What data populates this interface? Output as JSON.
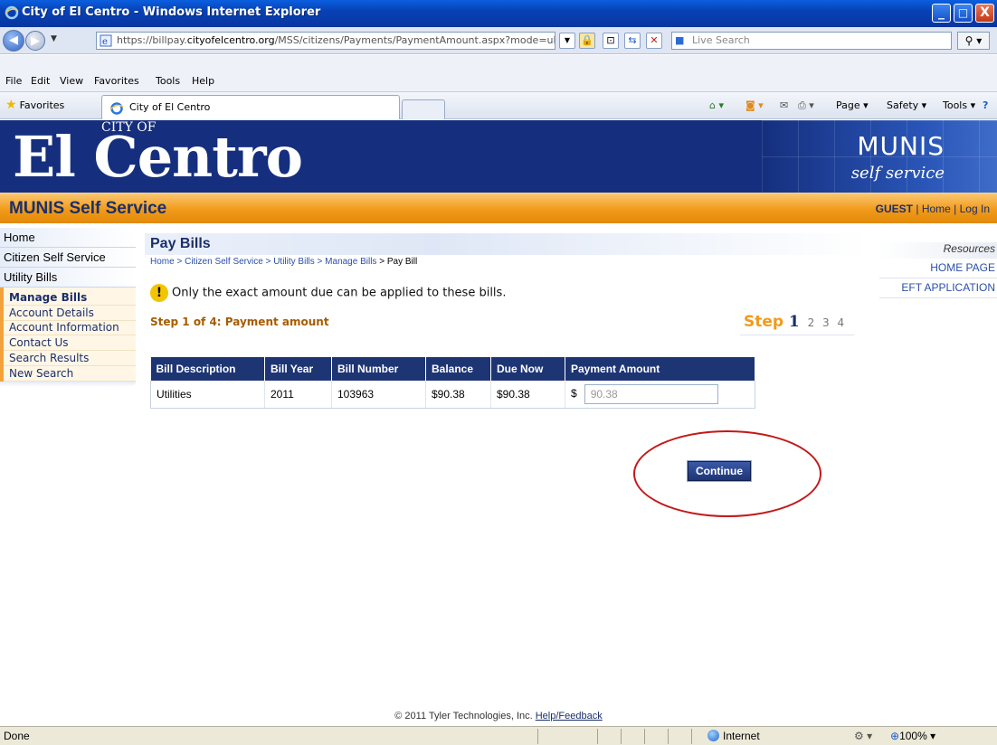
{
  "window": {
    "title": "City of El Centro - Windows Internet Explorer",
    "minimize": "_",
    "maximize": "□",
    "close": "X"
  },
  "addressbar": {
    "url_prefix": "https://billpay.",
    "url_domain": "cityofelcentro.org",
    "url_path": "/MSS/citizens/Payments/PaymentAmount.aspx?mode=ub",
    "search_placeholder": "Live Search"
  },
  "menu": {
    "file": "File",
    "edit": "Edit",
    "view": "View",
    "favorites": "Favorites",
    "tools": "Tools",
    "help": "Help"
  },
  "favbar": {
    "favorites_label": "Favorites",
    "tab_title": "City of El Centro",
    "page_menu": "Page ▾",
    "safety_menu": "Safety ▾",
    "tools_menu": "Tools ▾"
  },
  "banner": {
    "logo_city_of": "CITY OF",
    "logo_name": "El Centro",
    "brand": "MUNIS",
    "brand_sub": "self service"
  },
  "header": {
    "title": "MUNIS Self Service",
    "user": "GUEST",
    "sep1": " | ",
    "home": "Home",
    "sep2": " | ",
    "login": "Log In"
  },
  "leftnav": {
    "items": [
      "Home",
      "Citizen Self Service",
      "Utility Bills"
    ],
    "subitems": [
      "Manage Bills",
      "Account Details",
      "Account Information",
      "Contact Us",
      "Search Results",
      "New Search"
    ]
  },
  "page": {
    "title": "Pay Bills",
    "breadcrumb": [
      "Home",
      "Citizen Self Service",
      "Utility Bills",
      "Manage Bills",
      "Pay Bill"
    ],
    "breadcrumb_sep": " > ",
    "notice": "Only the exact amount due can be applied to these bills.",
    "step_heading": "Step 1 of 4: Payment amount",
    "step_label": "Step",
    "steps": [
      "1",
      "2",
      "3",
      "4"
    ]
  },
  "table": {
    "headers": [
      "Bill Description",
      "Bill Year",
      "Bill Number",
      "Balance",
      "Due Now",
      "Payment Amount"
    ],
    "rows": [
      {
        "description": "Utilities",
        "year": "2011",
        "number": "103963",
        "balance": "$90.38",
        "due_now": "$90.38",
        "currency": "$",
        "payment": "90.38"
      }
    ]
  },
  "continue_label": "Continue",
  "resources": {
    "heading": "Resources",
    "links": [
      "HOME PAGE",
      "EFT APPLICATION"
    ]
  },
  "footer": {
    "copyright": "© 2011 Tyler Technologies, Inc.",
    "link": "Help/Feedback"
  },
  "status": {
    "text": "Done",
    "zone": "Internet",
    "zoom": "100%"
  },
  "colors": {
    "banner_blue": "#152f7e",
    "orange": "#f19a18",
    "table_header": "#1e3574",
    "annotation_red": "#c41818"
  }
}
